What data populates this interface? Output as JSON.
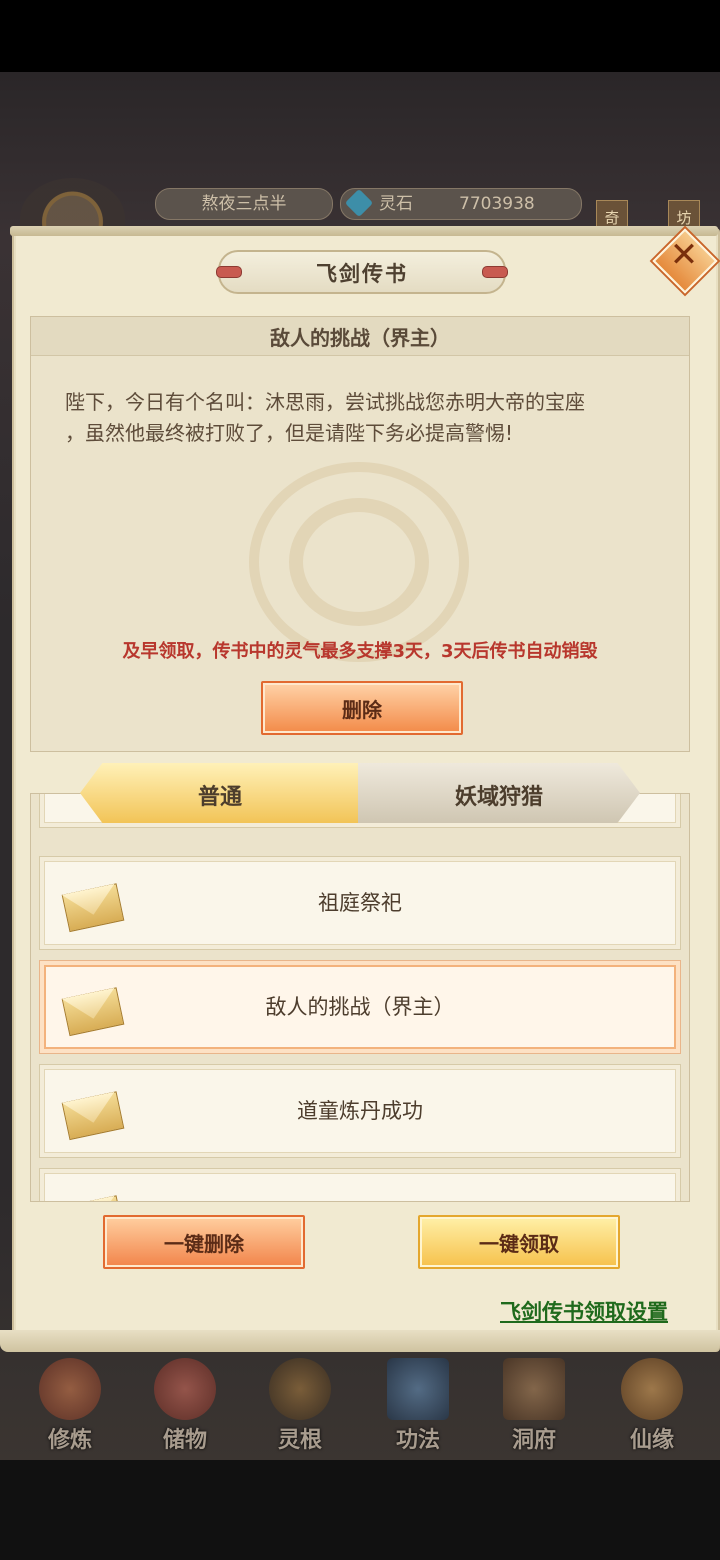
{
  "hud": {
    "player_name": "熬夜三点半",
    "currency_label": "灵石",
    "currency_value": "7703938",
    "tag_left": "奇",
    "tag_right": "坊"
  },
  "dialog": {
    "title": "飞剑传书",
    "close_icon": "close-icon"
  },
  "mail": {
    "title": "敌人的挑战（界主）",
    "body_line1": "陛下，今日有个名叫：沐思雨，尝试挑战您赤明大帝的宝座",
    "body_line2": "，虽然他最终被打败了，但是请陛下务必提高警惕!",
    "note": "及早领取，传书中的灵气最多支撑3天，3天后传书自动销毁",
    "delete_label": "删除"
  },
  "tabs": [
    {
      "label": "普通",
      "active": true
    },
    {
      "label": "妖域狩猎",
      "active": false
    }
  ],
  "list": [
    {
      "title": "祖庭祭祀",
      "selected": false
    },
    {
      "title": "敌人的挑战（界主）",
      "selected": true
    },
    {
      "title": "道童炼丹成功",
      "selected": false
    }
  ],
  "actions": {
    "delete_all": "一键删除",
    "claim_all": "一键领取",
    "settings_link": "飞剑传书领取设置"
  },
  "bottom_nav": [
    {
      "label": "修炼",
      "color": "#c8502c"
    },
    {
      "label": "储物",
      "color": "#c0463a"
    },
    {
      "label": "灵根",
      "color": "#8a5a2a"
    },
    {
      "label": "功法",
      "color": "#3a6a9a"
    },
    {
      "label": "洞府",
      "color": "#a07040"
    },
    {
      "label": "仙缘",
      "color": "#d09040"
    }
  ]
}
